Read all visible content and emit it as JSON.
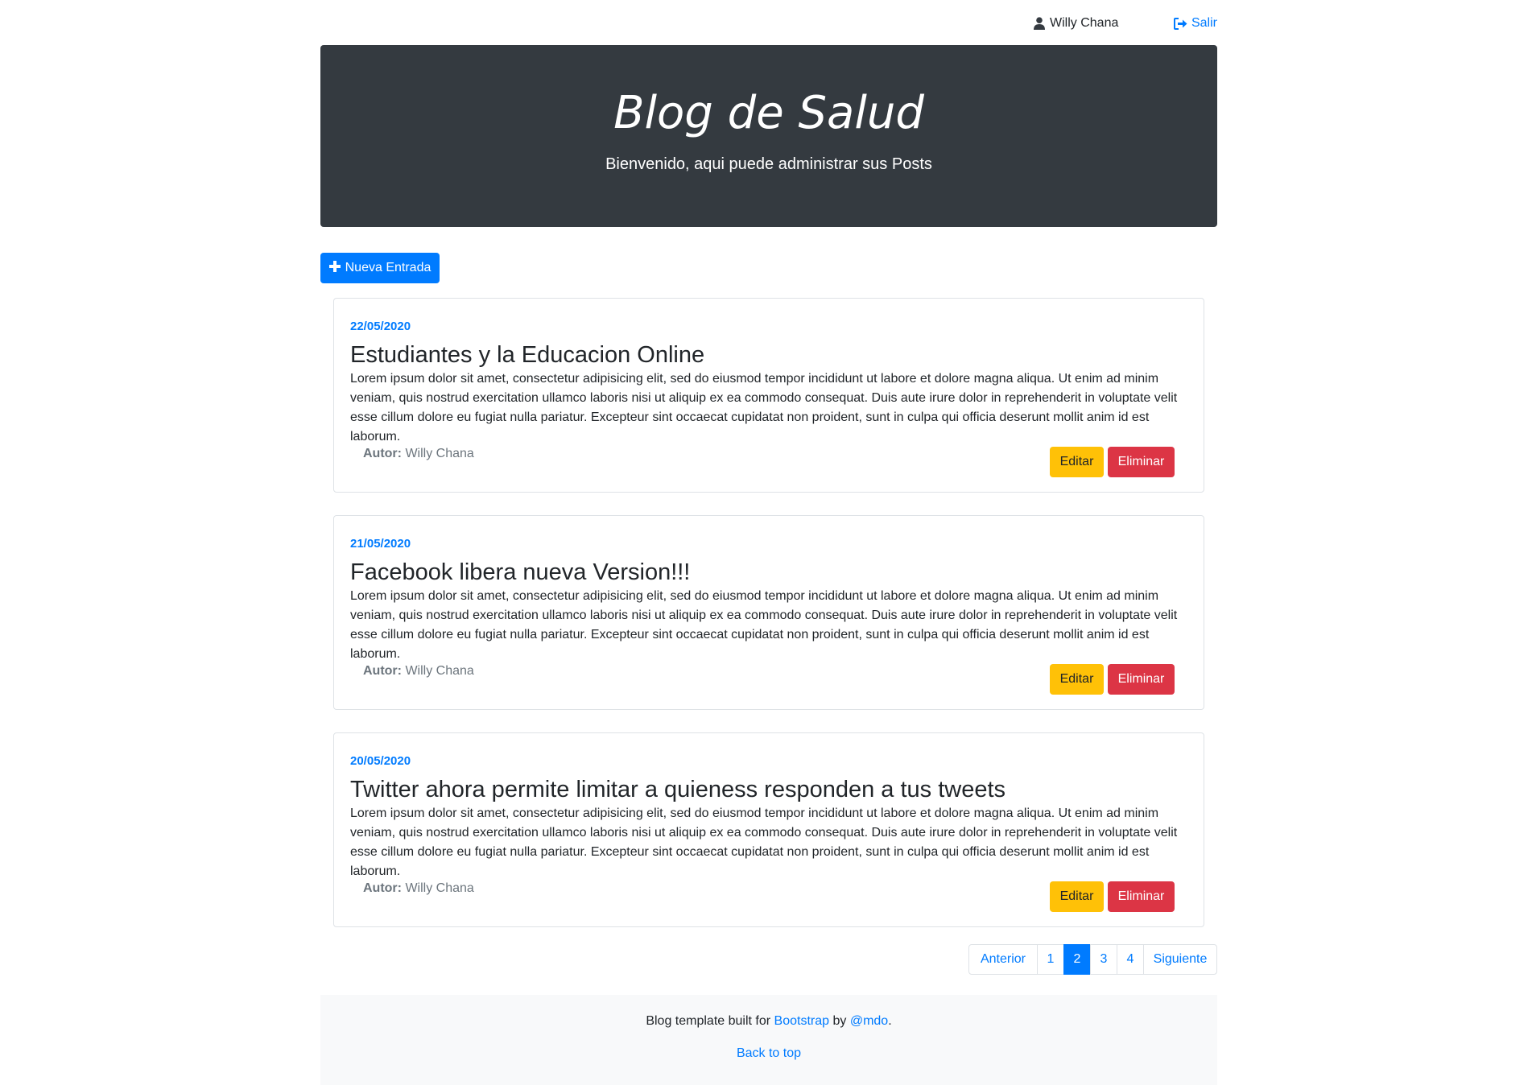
{
  "topbar": {
    "user_name": "Willy Chana",
    "logout_label": "Salir"
  },
  "hero": {
    "title": "Blog de Salud",
    "subtitle": "Bienvenido, aqui puede administrar sus Posts"
  },
  "actions": {
    "new_entry_label": "Nueva Entrada"
  },
  "posts": [
    {
      "date": "22/05/2020",
      "title": "Estudiantes y la Educacion Online",
      "body": "Lorem ipsum dolor sit amet, consectetur adipisicing elit, sed do eiusmod tempor incididunt ut labore et dolore magna aliqua. Ut enim ad minim veniam, quis nostrud exercitation ullamco laboris nisi ut aliquip ex ea commodo consequat. Duis aute irure dolor in reprehenderit in voluptate velit esse cillum dolore eu fugiat nulla pariatur. Excepteur sint occaecat cupidatat non proident, sunt in culpa qui officia deserunt mollit anim id est laborum.",
      "author_label": "Autor:",
      "author": "Willy Chana",
      "edit_label": "Editar",
      "delete_label": "Eliminar"
    },
    {
      "date": "21/05/2020",
      "title": "Facebook libera nueva Version!!!",
      "body": "Lorem ipsum dolor sit amet, consectetur adipisicing elit, sed do eiusmod tempor incididunt ut labore et dolore magna aliqua. Ut enim ad minim veniam, quis nostrud exercitation ullamco laboris nisi ut aliquip ex ea commodo consequat. Duis aute irure dolor in reprehenderit in voluptate velit esse cillum dolore eu fugiat nulla pariatur. Excepteur sint occaecat cupidatat non proident, sunt in culpa qui officia deserunt mollit anim id est laborum.",
      "author_label": "Autor:",
      "author": "Willy Chana",
      "edit_label": "Editar",
      "delete_label": "Eliminar"
    },
    {
      "date": "20/05/2020",
      "title": "Twitter ahora permite limitar a quieness responden a tus tweets",
      "body": "Lorem ipsum dolor sit amet, consectetur adipisicing elit, sed do eiusmod tempor incididunt ut labore et dolore magna aliqua. Ut enim ad minim veniam, quis nostrud exercitation ullamco laboris nisi ut aliquip ex ea commodo consequat. Duis aute irure dolor in reprehenderit in voluptate velit esse cillum dolore eu fugiat nulla pariatur. Excepteur sint occaecat cupidatat non proident, sunt in culpa qui officia deserunt mollit anim id est laborum.",
      "author_label": "Autor:",
      "author": "Willy Chana",
      "edit_label": "Editar",
      "delete_label": "Eliminar"
    }
  ],
  "pagination": {
    "prev_label": "Anterior",
    "pages": [
      "1",
      "2",
      "3",
      "4"
    ],
    "active_page": "2",
    "next_label": "Siguiente"
  },
  "footer": {
    "text_prefix": "Blog template built for",
    "bootstrap_link": "Bootstrap",
    "text_by": "by",
    "author_link": "@mdo",
    "text_suffix": ".",
    "back_to_top": "Back to top"
  },
  "icons": {
    "user": "user-icon",
    "logout": "sign-out-icon",
    "plus": "plus-icon"
  },
  "colors": {
    "primary": "#007bff",
    "warning": "#ffc107",
    "danger": "#dc3545",
    "dark": "#343a40"
  }
}
